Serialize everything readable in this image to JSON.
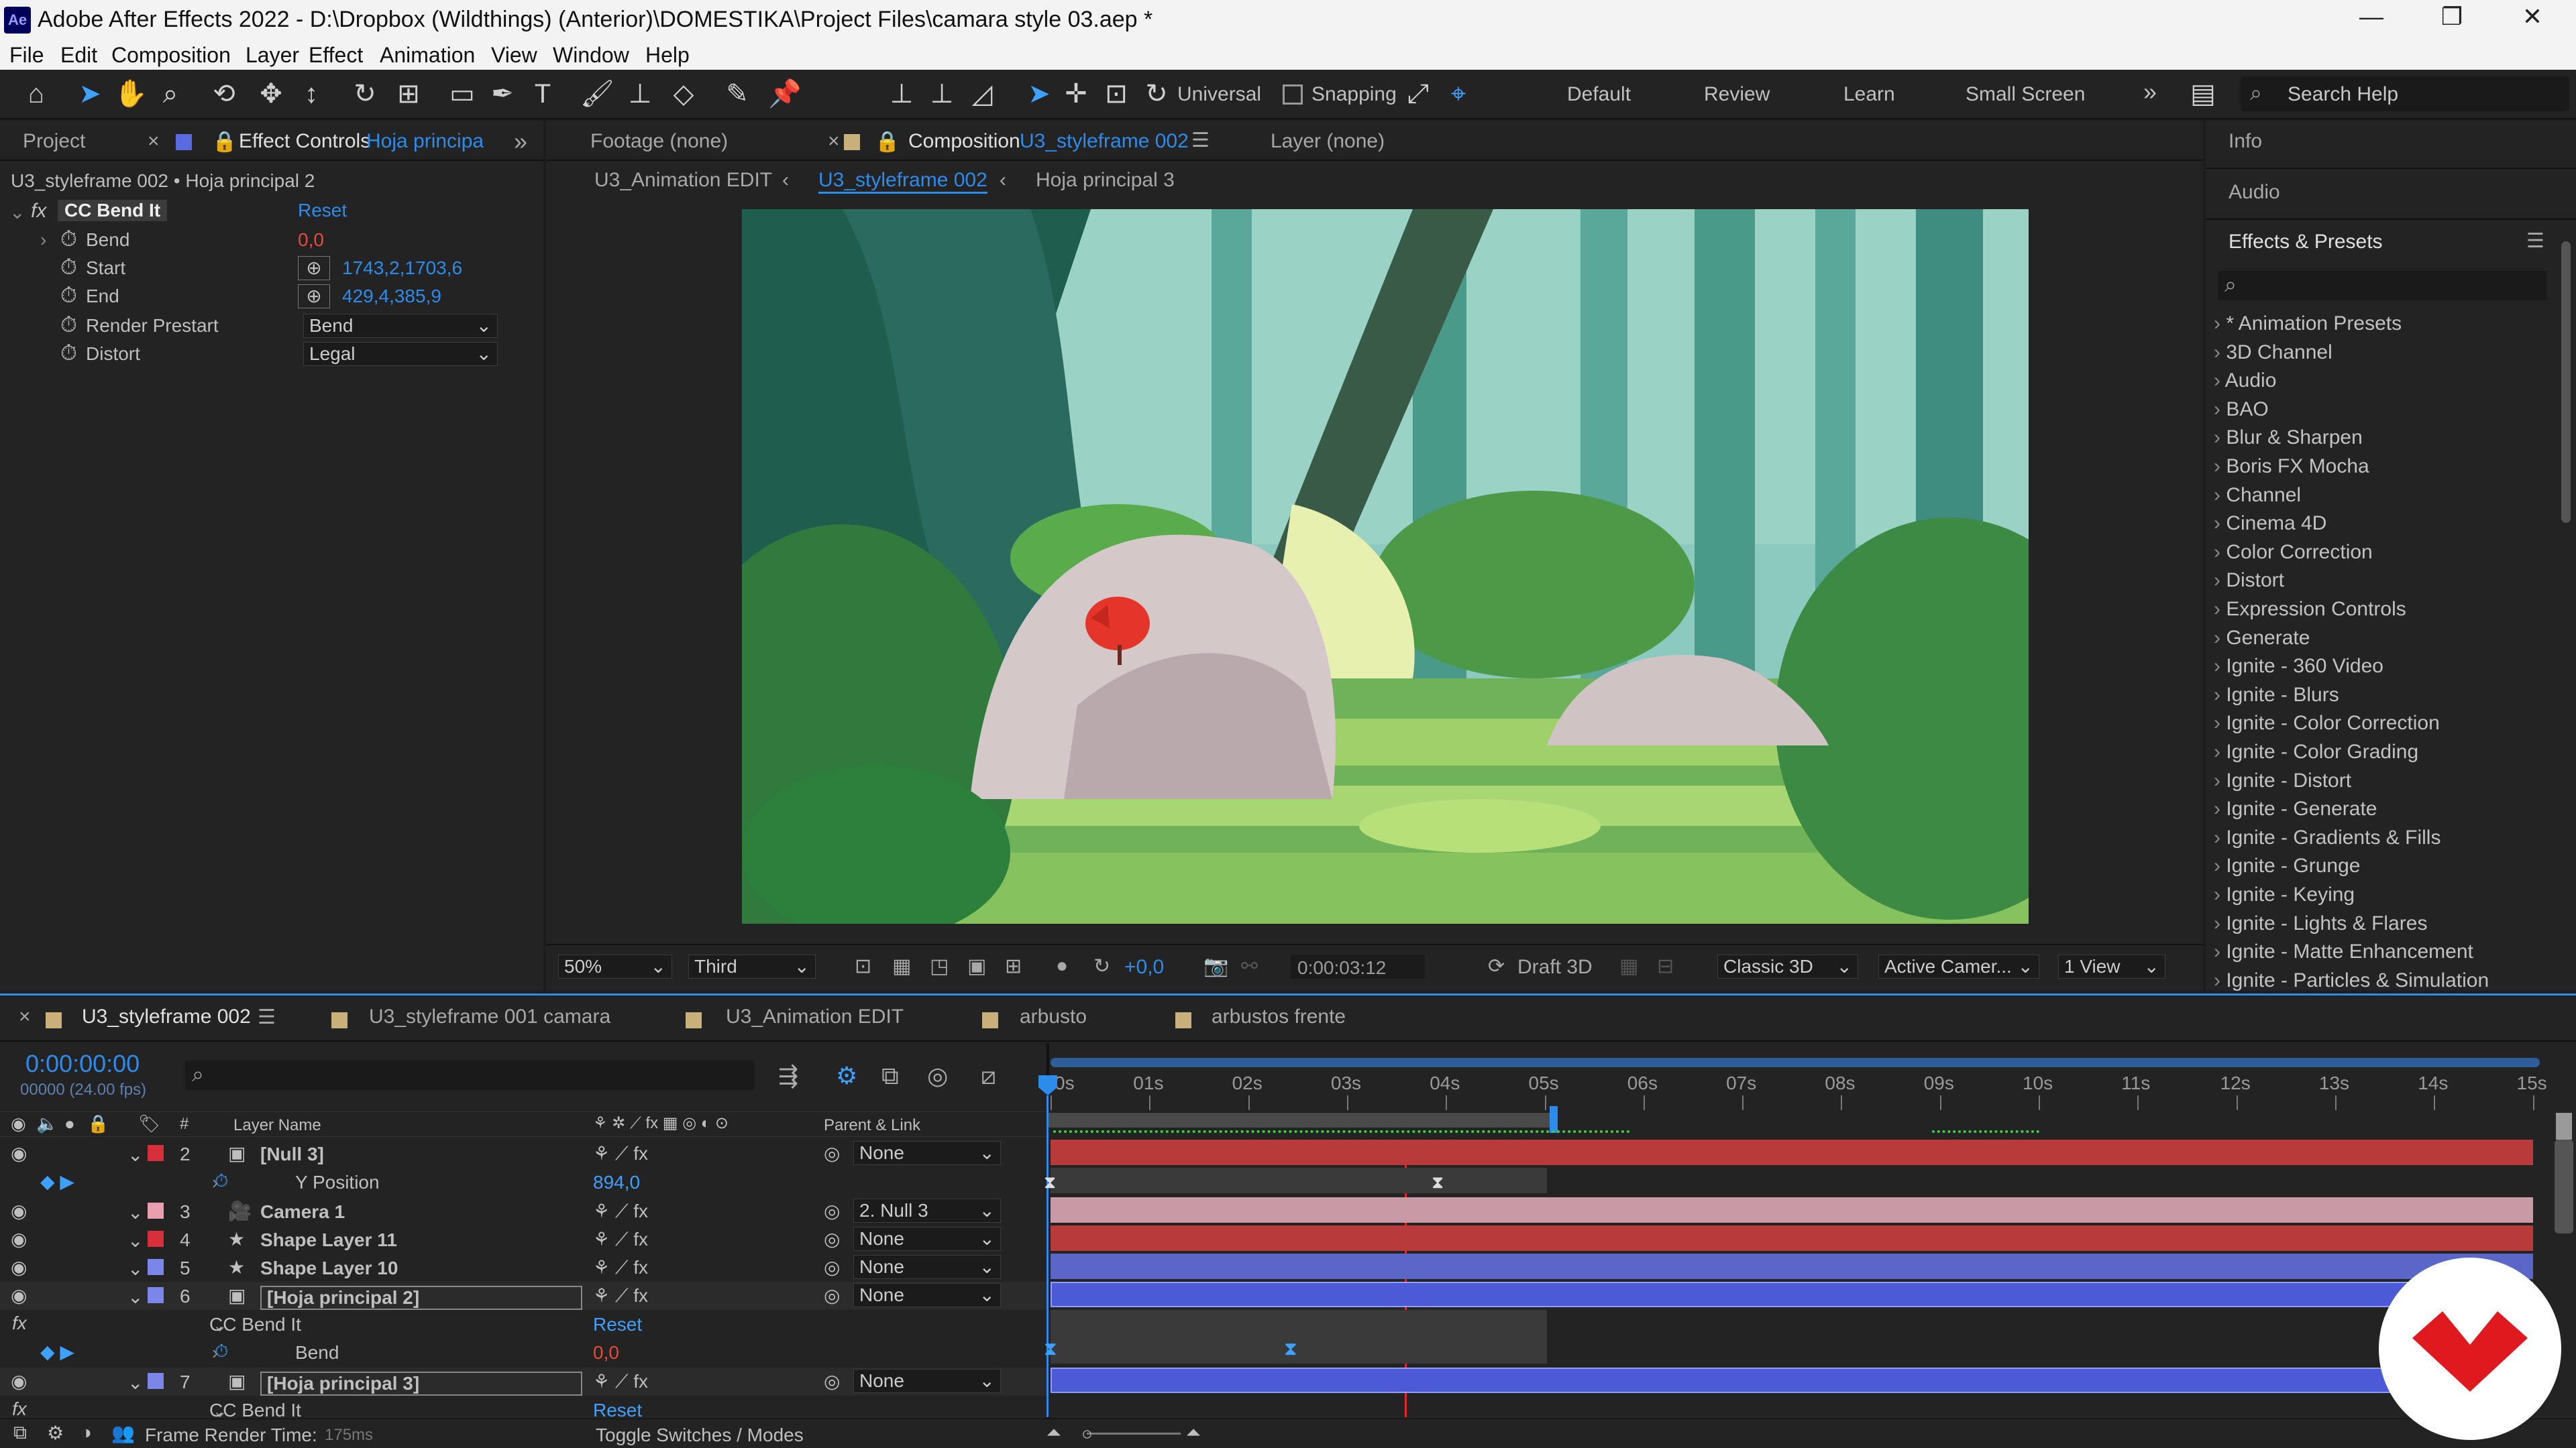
{
  "window": {
    "title": "Adobe After Effects 2022 - D:\\Dropbox (Wildthings) (Anterior)\\DOMESTIKA\\Project Files\\camara style 03.aep *",
    "app_icon": "Ae",
    "minimize": "—",
    "restore": "❐",
    "close": "✕"
  },
  "menu": [
    "File",
    "Edit",
    "Composition",
    "Layer",
    "Effect",
    "Animation",
    "View",
    "Window",
    "Help"
  ],
  "toolbar": {
    "universal_label": "Universal",
    "snapping_label": "Snapping",
    "workspaces": [
      "Default",
      "Review",
      "Learn",
      "Small Screen"
    ],
    "more": "»",
    "search_placeholder": "Search Help"
  },
  "left_panel": {
    "tab_project": "Project",
    "tab_effect_controls": "Effect Controls",
    "tab_effect_controls_target": "Hoja principa",
    "breadcrumb": "U3_styleframe 002 • Hoja principal 2",
    "effect_name": "CC Bend It",
    "reset": "Reset",
    "props": [
      {
        "name": "Bend",
        "value": "0,0"
      },
      {
        "name": "Start",
        "value": "1743,2,1703,6"
      },
      {
        "name": "End",
        "value": "429,4,385,9"
      },
      {
        "name": "Render Prestart",
        "value": "Bend"
      },
      {
        "name": "Distort",
        "value": "Legal"
      }
    ]
  },
  "viewer": {
    "tab_footage": "Footage (none)",
    "tab_composition": "Composition",
    "tab_composition_name": "U3_styleframe 002",
    "tab_layer": "Layer (none)",
    "crumbs": [
      "U3_Animation EDIT",
      "U3_styleframe 002",
      "Hoja principal 3"
    ],
    "zoom": "50%",
    "resolution": "Third",
    "exposure": "+0,0",
    "timecode": "0:00:03:12",
    "draft3d": "Draft 3D",
    "renderer": "Classic 3D",
    "camera": "Active Camer...",
    "views": "1 View"
  },
  "right_panel": {
    "info": "Info",
    "audio": "Audio",
    "effects_presets": "Effects & Presets",
    "search_glyph": "⌕",
    "items": [
      "* Animation Presets",
      "3D Channel",
      "Audio",
      "BAO",
      "Blur & Sharpen",
      "Boris FX Mocha",
      "Channel",
      "Cinema 4D",
      "Color Correction",
      "Distort",
      "Expression Controls",
      "Generate",
      "Ignite - 360 Video",
      "Ignite - Blurs",
      "Ignite - Color Correction",
      "Ignite - Color Grading",
      "Ignite - Distort",
      "Ignite - Generate",
      "Ignite - Gradients & Fills",
      "Ignite - Grunge",
      "Ignite - Keying",
      "Ignite - Lights & Flares",
      "Ignite - Matte Enhancement",
      "Ignite - Particles & Simulation"
    ]
  },
  "timeline": {
    "tabs": [
      "U3_styleframe 002",
      "U3_styleframe 001 camara",
      "U3_Animation EDIT",
      "arbusto",
      "arbustos frente"
    ],
    "timecode": "0:00:00:00",
    "frame_info": "00000 (24.00 fps)",
    "col_layer_name": "Layer Name",
    "col_parent": "Parent & Link",
    "ruler": [
      "0s",
      "01s",
      "02s",
      "03s",
      "04s",
      "05s",
      "06s",
      "07s",
      "08s",
      "09s",
      "10s",
      "11s",
      "12s",
      "13s",
      "14s",
      "15s"
    ],
    "rows": [
      {
        "num": "2",
        "name": "[Null 3]",
        "parent": "None",
        "color": "#d8303a"
      },
      {
        "sub": "Y Position",
        "value": "894,0"
      },
      {
        "num": "3",
        "name": "Camera 1",
        "parent": "2. Null 3",
        "color": "#e8a0b0"
      },
      {
        "num": "4",
        "name": "Shape Layer 11",
        "parent": "None",
        "color": "#d8303a"
      },
      {
        "num": "5",
        "name": "Shape Layer 10",
        "parent": "None",
        "color": "#7a86e8"
      },
      {
        "num": "6",
        "name": "[Hoja principal 2]",
        "parent": "None",
        "color": "#7a86e8"
      },
      {
        "sub": "CC Bend It",
        "value": "Reset"
      },
      {
        "sub": "Bend",
        "value": "0,0"
      },
      {
        "num": "7",
        "name": "[Hoja principal 3]",
        "parent": "None",
        "color": "#7a86e8"
      },
      {
        "sub": "CC Bend It",
        "value": "Reset"
      }
    ],
    "render_time_label": "Frame Render Time:",
    "render_time_value": "175ms",
    "toggle_label": "Toggle Switches / Modes"
  }
}
